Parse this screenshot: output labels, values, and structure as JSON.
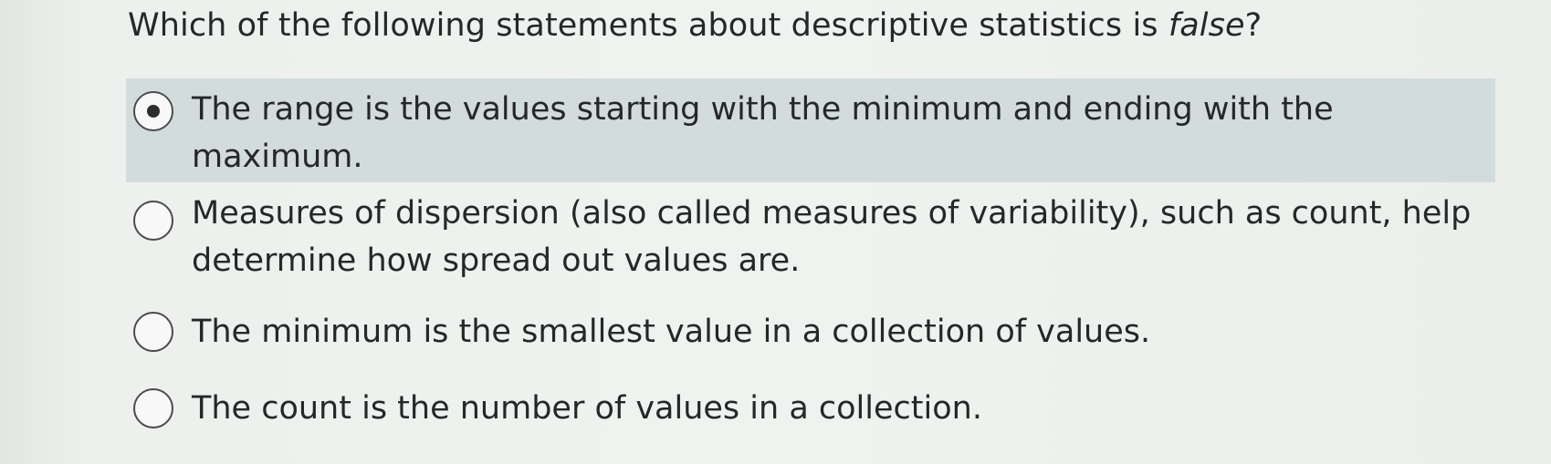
{
  "question": {
    "text_before": "Which of the following statements about descriptive statistics is ",
    "text_emphasis": "false",
    "text_after": "?"
  },
  "options": [
    {
      "label": "The range is the values starting with the minimum and ending with the maximum.",
      "selected": true
    },
    {
      "label": "Measures of dispersion (also called measures of variability), such as count, help determine how spread out values are.",
      "selected": false
    },
    {
      "label": "The minimum is the smallest value in a collection of values.",
      "selected": false
    },
    {
      "label": "The count is the number of values in a collection.",
      "selected": false
    }
  ],
  "colors": {
    "selected_background": "#d3dcdc",
    "text": "#262828",
    "page_background": "#eef0ee"
  }
}
